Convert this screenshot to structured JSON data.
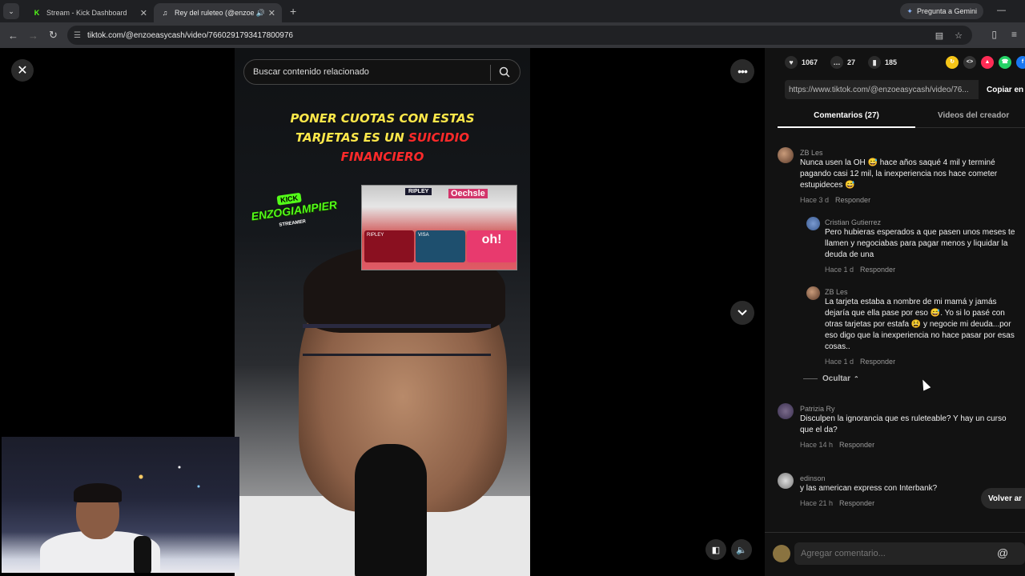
{
  "browser": {
    "tabs": [
      {
        "title": "Stream - Kick Dashboard",
        "favicon": "kick-icon"
      },
      {
        "title": "Rey del ruleteo (@enzoeas",
        "favicon": "tiktok-icon"
      }
    ],
    "gemini_label": "Pregunta a Gemini",
    "url": "tiktok.com/@enzoeasycash/video/7660291793417800976"
  },
  "viewer": {
    "search_placeholder": "Buscar contenido relacionado",
    "caption_line1": "PONER CUOTAS CON ESTAS",
    "caption_line2a": "TARJETAS ES UN ",
    "caption_line2b": "SUICIDIO",
    "caption_line3": "FINANCIERO",
    "kick_badge": "KICK",
    "kick_name": "ENZOGIAMPIER",
    "kick_sub": "STREAMER",
    "store_ripley": "RIPLEY",
    "store_oechsle": "Oechsle",
    "card_oh": "oh!",
    "card_visa": "VISA"
  },
  "panel": {
    "likes": "1067",
    "comments_count": "27",
    "saves": "185",
    "link": "https://www.tiktok.com/@enzoeasycash/video/76...",
    "copy_label": "Copiar en",
    "tab_comments": "Comentarios (27)",
    "tab_creator": "Videos del creador",
    "comments": [
      {
        "user": "ZB Les",
        "text": "Nunca usen la OH 😅 hace años saqué 4 mil y terminé pagando casi 12 mil, la inexperiencia nos hace cometer estupideces 😅",
        "time": "Hace 3 d",
        "reply": "Responder"
      },
      {
        "user": "Cristian Gutierrez",
        "text": "Pero hubieras esperados a que pasen unos meses te llamen y negociabas para pagar menos y liquidar la deuda de una",
        "time": "Hace 1 d",
        "reply": "Responder"
      },
      {
        "user": "ZB Les",
        "text": "La tarjeta estaba a nombre de mi mamá y jamás dejaría que ella pase por eso 😅. Yo si lo pasé con otras tarjetas por estafa 😫 y negocie mi deuda...por eso digo que la inexperiencia no hace pasar por esas cosas..",
        "time": "Hace 1 d",
        "reply": "Responder"
      },
      {
        "user": "Patrizia Ry",
        "text": "Disculpen la ignorancia que es ruleteable? Y hay un curso que el da?",
        "time": "Hace 14 h",
        "reply": "Responder"
      },
      {
        "user": "edinson",
        "text": "y las american express con Interbank?",
        "time": "Hace 21 h",
        "reply": "Responder"
      }
    ],
    "hide_label": "Ocultar",
    "volver_label": "Volver ar",
    "add_comment_placeholder": "Agregar comentario..."
  }
}
